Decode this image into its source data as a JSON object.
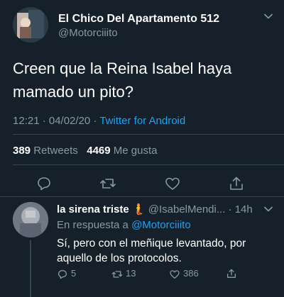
{
  "tweet": {
    "author_name": "El Chico Del Apartamento 512",
    "author_handle": "@Motorciiito",
    "text": "Creen que la Reina Isabel haya mamado un pito?",
    "time": "12:21 · 04/02/20 ·",
    "source": "Twitter for Android",
    "retweets_count": "389",
    "retweets_label": "Retweets",
    "likes_count": "4469",
    "likes_label": "Me gusta",
    "actions": [
      "reply-icon",
      "retweet-icon",
      "like-icon",
      "share-icon"
    ]
  },
  "reply": {
    "author_name": "la sirena triste",
    "author_handle": "@IsabelMendi...",
    "time": "· 14h",
    "in_reply_to_label": "En respuesta a",
    "in_reply_to_handle": "@Motorciiito",
    "text": "Sí, pero con el meñique levantado, por aquello de los protocolos.",
    "reply_count": "5",
    "retweet_count": "13",
    "like_count": "386"
  },
  "colors": {
    "background": "#15202b",
    "text": "#ffffff",
    "muted": "#8899a6",
    "accent": "#1da1f2",
    "divider": "#38444d"
  }
}
